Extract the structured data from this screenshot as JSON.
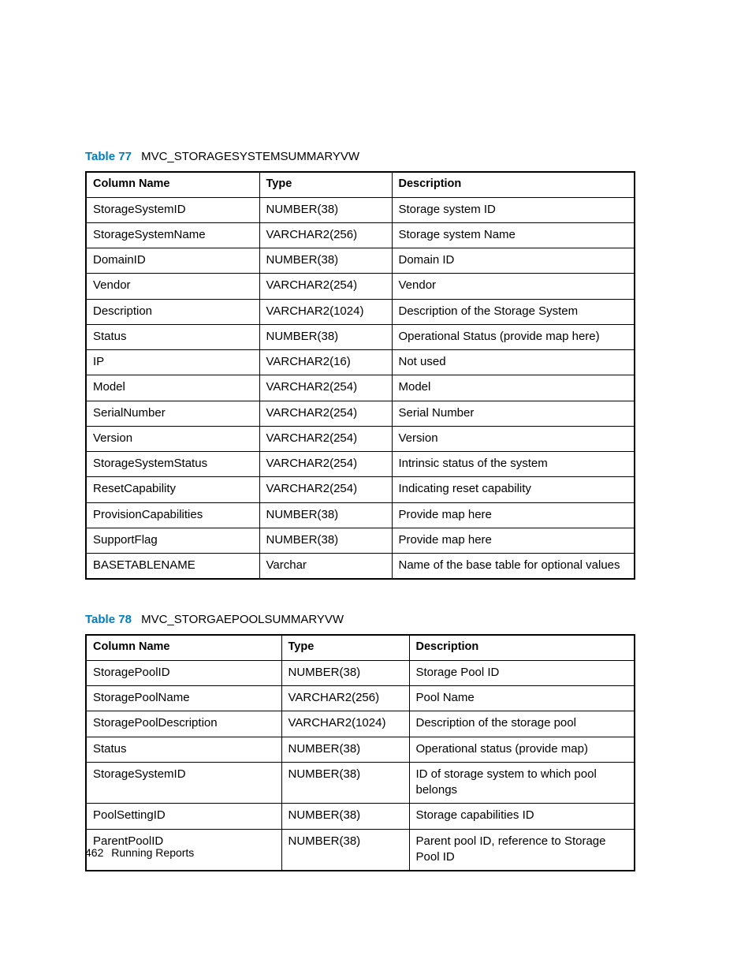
{
  "tables": [
    {
      "label": "Table 77",
      "title": "MVC_STORAGESYSTEMSUMMARYVW",
      "headers": [
        "Column Name",
        "Type",
        "Description"
      ],
      "rows": [
        [
          "StorageSystemID",
          "NUMBER(38)",
          "Storage system ID"
        ],
        [
          "StorageSystemName",
          "VARCHAR2(256)",
          "Storage system Name"
        ],
        [
          "DomainID",
          "NUMBER(38)",
          "Domain ID"
        ],
        [
          "Vendor",
          "VARCHAR2(254)",
          "Vendor"
        ],
        [
          "Description",
          "VARCHAR2(1024)",
          "Description of the Storage System"
        ],
        [
          "Status",
          "NUMBER(38)",
          "Operational Status (provide map here)"
        ],
        [
          "IP",
          "VARCHAR2(16)",
          "Not used"
        ],
        [
          "Model",
          "VARCHAR2(254)",
          "Model"
        ],
        [
          "SerialNumber",
          "VARCHAR2(254)",
          "Serial Number"
        ],
        [
          "Version",
          "VARCHAR2(254)",
          "Version"
        ],
        [
          "StorageSystemStatus",
          "VARCHAR2(254)",
          "Intrinsic status of the system"
        ],
        [
          "ResetCapability",
          "VARCHAR2(254)",
          "Indicating reset capability"
        ],
        [
          "ProvisionCapabilities",
          "NUMBER(38)",
          "Provide map here"
        ],
        [
          "SupportFlag",
          "NUMBER(38)",
          "Provide map here"
        ],
        [
          "BASETABLENAME",
          "Varchar",
          "Name of the base table for optional values"
        ]
      ]
    },
    {
      "label": "Table 78",
      "title": "MVC_STORGAEPOOLSUMMARYVW",
      "headers": [
        "Column Name",
        "Type",
        "Description"
      ],
      "rows": [
        [
          "StoragePoolID",
          "NUMBER(38)",
          "Storage Pool ID"
        ],
        [
          "StoragePoolName",
          "VARCHAR2(256)",
          "Pool Name"
        ],
        [
          "StoragePoolDescription",
          "VARCHAR2(1024)",
          "Description of the storage pool"
        ],
        [
          "Status",
          "NUMBER(38)",
          "Operational status (provide map)"
        ],
        [
          "StorageSystemID",
          "NUMBER(38)",
          "ID of storage system to which pool belongs"
        ],
        [
          "PoolSettingID",
          "NUMBER(38)",
          "Storage capabilities ID"
        ],
        [
          "ParentPoolID",
          "NUMBER(38)",
          "Parent pool ID, reference to Storage Pool ID"
        ]
      ]
    }
  ],
  "footer": {
    "page": "462",
    "section": "Running Reports"
  }
}
